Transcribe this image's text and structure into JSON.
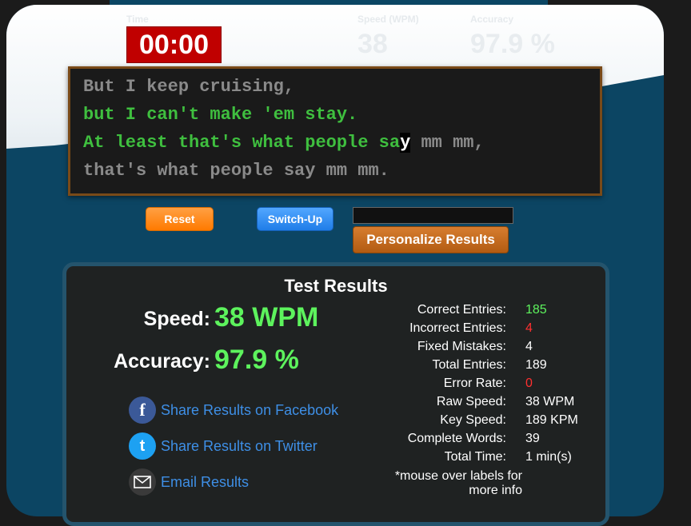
{
  "header": {
    "time_label": "Time",
    "time_value": "00:00",
    "speed_label": "Speed (WPM)",
    "speed_value": "38",
    "accuracy_label": "Accuracy",
    "accuracy_value": "97.9 %"
  },
  "typing": {
    "line1": "But I keep cruising,",
    "line2": "but I can't make 'em stay.",
    "line3_typed": "At least that's what people sa",
    "line3_cursor": "y",
    "line3_rest": " mm mm,",
    "line4": "that's what people say mm mm."
  },
  "controls": {
    "reset_label": "Reset",
    "switch_label": "Switch-Up",
    "name_value": "",
    "personalize_label": "Personalize Results"
  },
  "results": {
    "title": "Test Results",
    "speed_label": "Speed:",
    "speed_value": "38 WPM",
    "accuracy_label": "Accuracy:",
    "accuracy_value": "97.9 %",
    "share_facebook": "Share Results on Facebook",
    "share_twitter": "Share Results on Twitter",
    "email": "Email Results",
    "details": [
      {
        "label": "Correct Entries:",
        "value": "185",
        "color": "#5df35d"
      },
      {
        "label": "Incorrect Entries:",
        "value": "4",
        "color": "#ff3030"
      },
      {
        "label": "Fixed Mistakes:",
        "value": "4",
        "color": "#ffffff"
      },
      {
        "label": "Total Entries:",
        "value": "189",
        "color": "#ffffff"
      },
      {
        "label": "Error Rate:",
        "value": "0",
        "color": "#ff3030"
      },
      {
        "label": "Raw Speed:",
        "value": "38 WPM",
        "color": "#ffffff"
      },
      {
        "label": "Key Speed:",
        "value": "189 KPM",
        "color": "#ffffff"
      },
      {
        "label": "Complete Words:",
        "value": "39",
        "color": "#ffffff"
      },
      {
        "label": "Total Time:",
        "value": "1 min(s)",
        "color": "#ffffff"
      }
    ],
    "note": "*mouse over labels for more info"
  },
  "colors": {
    "timer_bg": "#c00000",
    "typed_green": "#3fbf3f",
    "pending_gray": "#8a8a8a",
    "result_green": "#5df35d",
    "error_red": "#ff3030",
    "link_blue": "#3e8fe6"
  },
  "icons": [
    "facebook-icon",
    "twitter-icon",
    "email-icon"
  ]
}
